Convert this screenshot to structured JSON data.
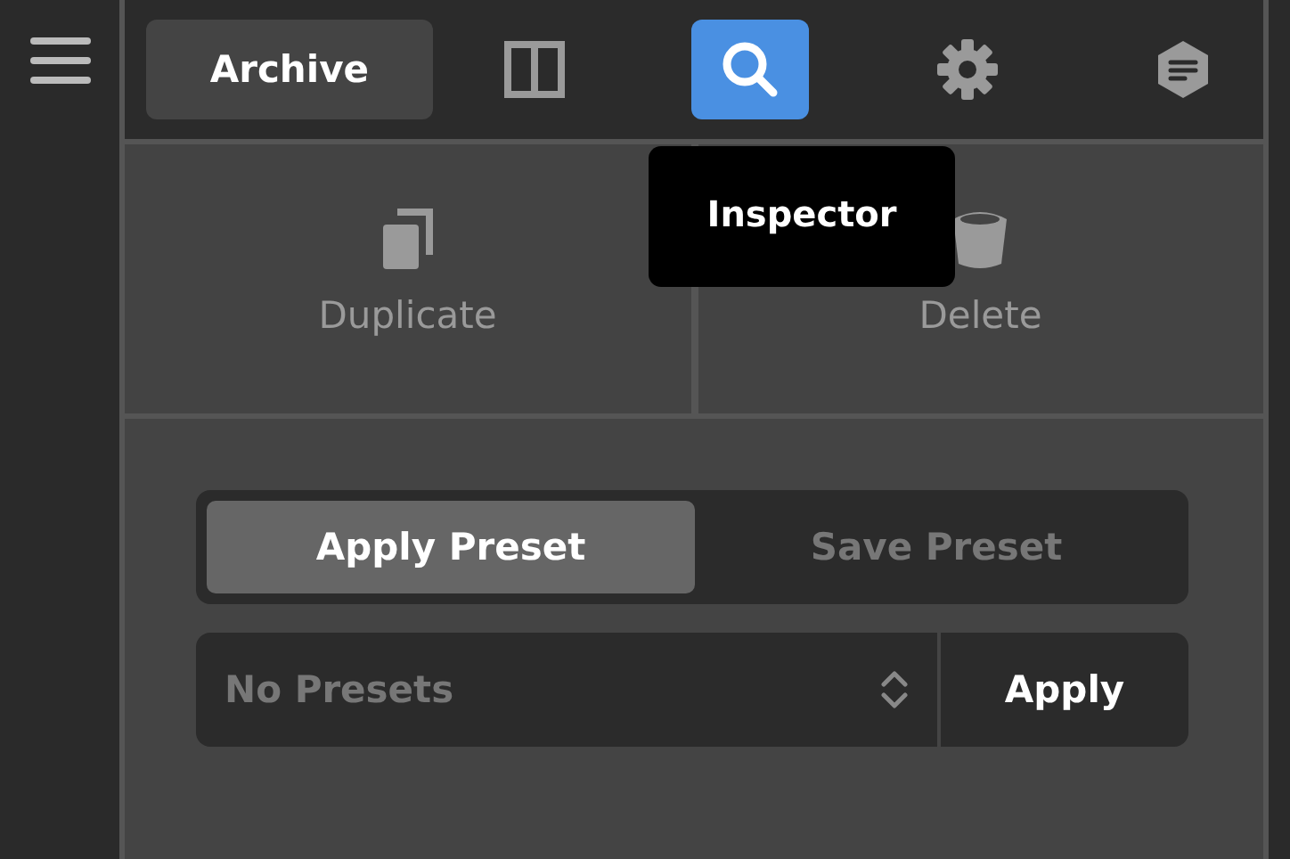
{
  "toolbar": {
    "archive_button": "Archive",
    "tools": [
      {
        "kind": "layout",
        "selected": false
      },
      {
        "kind": "search",
        "selected": true
      },
      {
        "kind": "settings",
        "selected": false
      },
      {
        "kind": "notes",
        "selected": false
      }
    ],
    "tooltip": "Inspector"
  },
  "actions": [
    {
      "kind": "duplicate",
      "label": "Duplicate"
    },
    {
      "kind": "delete",
      "label": "Delete"
    }
  ],
  "presets": {
    "tabs": [
      {
        "label": "Apply Preset",
        "selected": true
      },
      {
        "label": "Save Preset",
        "selected": false
      }
    ],
    "select": {
      "value": "No Presets"
    },
    "apply_button": "Apply"
  }
}
